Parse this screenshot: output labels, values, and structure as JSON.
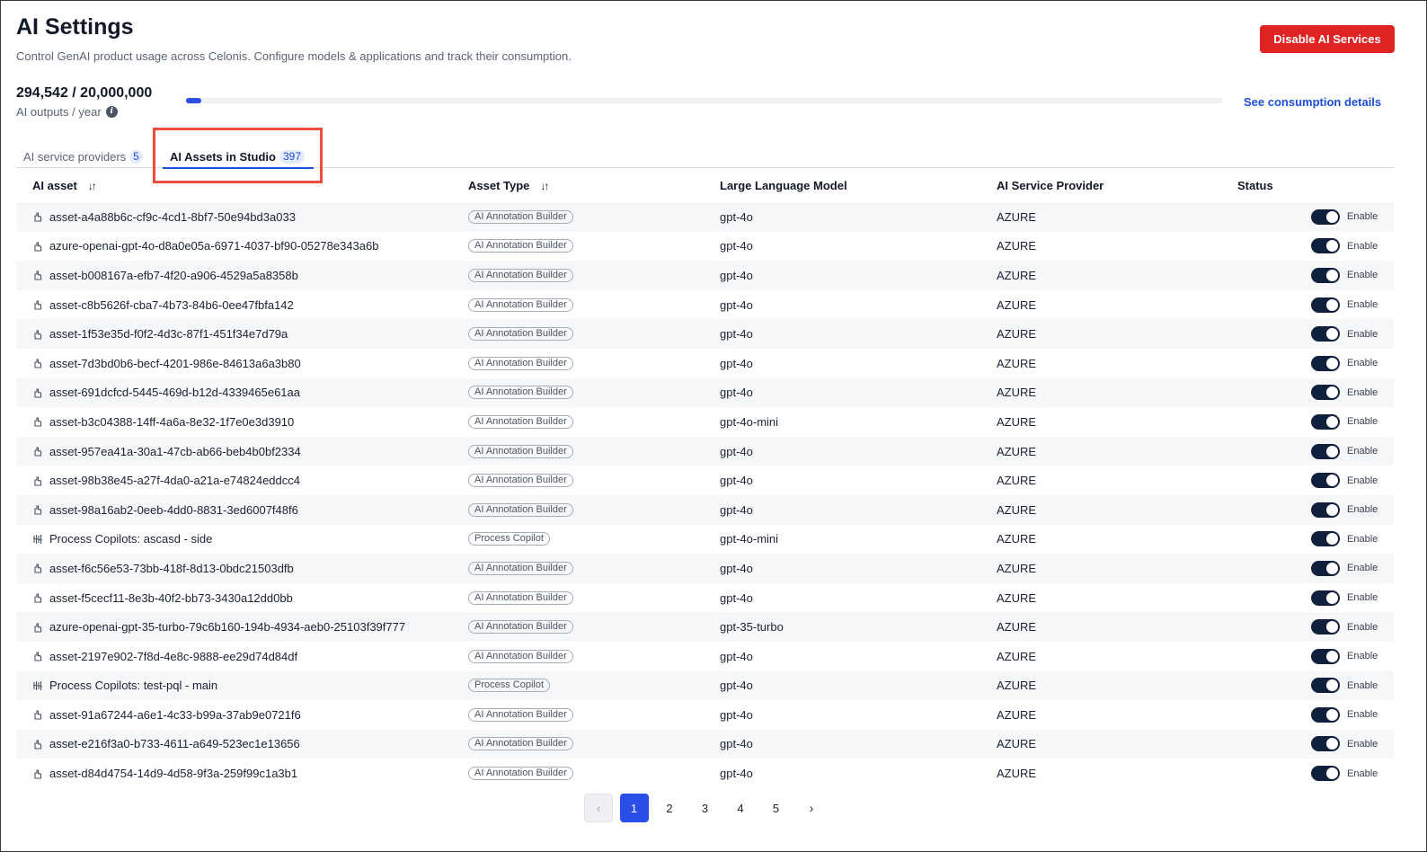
{
  "header": {
    "title": "AI Settings",
    "subtitle": "Control GenAI product usage across Celonis. Configure models & applications and track their consumption.",
    "disable_button": "Disable AI Services"
  },
  "usage": {
    "value": "294,542 / 20,000,000",
    "label": "AI outputs / year",
    "progress_fraction": 0.0147,
    "details_link": "See consumption details"
  },
  "tabs": [
    {
      "label": "AI service providers",
      "count": "5"
    },
    {
      "label": "AI Assets in Studio",
      "count": "397"
    }
  ],
  "table": {
    "columns": [
      "AI asset",
      "Asset Type",
      "Large Language Model",
      "AI Service Provider",
      "Status"
    ],
    "rows": [
      {
        "icon": "annotation-builder-icon",
        "asset": "asset-a4a88b6c-cf9c-4cd1-8bf7-50e94bd3a033",
        "type": "AI Annotation Builder",
        "llm": "gpt-4o",
        "provider": "AZURE",
        "status": "Enable"
      },
      {
        "icon": "annotation-builder-icon",
        "asset": "azure-openai-gpt-4o-d8a0e05a-6971-4037-bf90-05278e343a6b",
        "type": "AI Annotation Builder",
        "llm": "gpt-4o",
        "provider": "AZURE",
        "status": "Enable"
      },
      {
        "icon": "annotation-builder-icon",
        "asset": "asset-b008167a-efb7-4f20-a906-4529a5a8358b",
        "type": "AI Annotation Builder",
        "llm": "gpt-4o",
        "provider": "AZURE",
        "status": "Enable"
      },
      {
        "icon": "annotation-builder-icon",
        "asset": "asset-c8b5626f-cba7-4b73-84b6-0ee47fbfa142",
        "type": "AI Annotation Builder",
        "llm": "gpt-4o",
        "provider": "AZURE",
        "status": "Enable"
      },
      {
        "icon": "annotation-builder-icon",
        "asset": "asset-1f53e35d-f0f2-4d3c-87f1-451f34e7d79a",
        "type": "AI Annotation Builder",
        "llm": "gpt-4o",
        "provider": "AZURE",
        "status": "Enable"
      },
      {
        "icon": "annotation-builder-icon",
        "asset": "asset-7d3bd0b6-becf-4201-986e-84613a6a3b80",
        "type": "AI Annotation Builder",
        "llm": "gpt-4o",
        "provider": "AZURE",
        "status": "Enable"
      },
      {
        "icon": "annotation-builder-icon",
        "asset": "asset-691dcfcd-5445-469d-b12d-4339465e61aa",
        "type": "AI Annotation Builder",
        "llm": "gpt-4o",
        "provider": "AZURE",
        "status": "Enable"
      },
      {
        "icon": "annotation-builder-icon",
        "asset": "asset-b3c04388-14ff-4a6a-8e32-1f7e0e3d3910",
        "type": "AI Annotation Builder",
        "llm": "gpt-4o-mini",
        "provider": "AZURE",
        "status": "Enable"
      },
      {
        "icon": "annotation-builder-icon",
        "asset": "asset-957ea41a-30a1-47cb-ab66-beb4b0bf2334",
        "type": "AI Annotation Builder",
        "llm": "gpt-4o",
        "provider": "AZURE",
        "status": "Enable"
      },
      {
        "icon": "annotation-builder-icon",
        "asset": "asset-98b38e45-a27f-4da0-a21a-e74824eddcc4",
        "type": "AI Annotation Builder",
        "llm": "gpt-4o",
        "provider": "AZURE",
        "status": "Enable"
      },
      {
        "icon": "annotation-builder-icon",
        "asset": "asset-98a16ab2-0eeb-4dd0-8831-3ed6007f48f6",
        "type": "AI Annotation Builder",
        "llm": "gpt-4o",
        "provider": "AZURE",
        "status": "Enable"
      },
      {
        "icon": "process-copilot-icon",
        "asset": "Process Copilots: ascasd - side",
        "type": "Process Copilot",
        "llm": "gpt-4o-mini",
        "provider": "AZURE",
        "status": "Enable"
      },
      {
        "icon": "annotation-builder-icon",
        "asset": "asset-f6c56e53-73bb-418f-8d13-0bdc21503dfb",
        "type": "AI Annotation Builder",
        "llm": "gpt-4o",
        "provider": "AZURE",
        "status": "Enable"
      },
      {
        "icon": "annotation-builder-icon",
        "asset": "asset-f5cecf11-8e3b-40f2-bb73-3430a12dd0bb",
        "type": "AI Annotation Builder",
        "llm": "gpt-4o",
        "provider": "AZURE",
        "status": "Enable"
      },
      {
        "icon": "annotation-builder-icon",
        "asset": "azure-openai-gpt-35-turbo-79c6b160-194b-4934-aeb0-25103f39f777",
        "type": "AI Annotation Builder",
        "llm": "gpt-35-turbo",
        "provider": "AZURE",
        "status": "Enable"
      },
      {
        "icon": "annotation-builder-icon",
        "asset": "asset-2197e902-7f8d-4e8c-9888-ee29d74d84df",
        "type": "AI Annotation Builder",
        "llm": "gpt-4o",
        "provider": "AZURE",
        "status": "Enable"
      },
      {
        "icon": "process-copilot-icon",
        "asset": "Process Copilots: test-pql - main",
        "type": "Process Copilot",
        "llm": "gpt-4o",
        "provider": "AZURE",
        "status": "Enable"
      },
      {
        "icon": "annotation-builder-icon",
        "asset": "asset-91a67244-a6e1-4c33-b99a-37ab9e0721f6",
        "type": "AI Annotation Builder",
        "llm": "gpt-4o",
        "provider": "AZURE",
        "status": "Enable"
      },
      {
        "icon": "annotation-builder-icon",
        "asset": "asset-e216f3a0-b733-4611-a649-523ec1e13656",
        "type": "AI Annotation Builder",
        "llm": "gpt-4o",
        "provider": "AZURE",
        "status": "Enable"
      },
      {
        "icon": "annotation-builder-icon",
        "asset": "asset-d84d4754-14d9-4d58-9f3a-259f99c1a3b1",
        "type": "AI Annotation Builder",
        "llm": "gpt-4o",
        "provider": "AZURE",
        "status": "Enable"
      }
    ]
  },
  "pagination": {
    "pages": [
      "1",
      "2",
      "3",
      "4",
      "5"
    ],
    "current": "1",
    "prev_icon": "chevron-left-icon",
    "next_icon": "chevron-right-icon"
  },
  "colors": {
    "accent": "#2c4ee8",
    "danger": "#e02424",
    "toggle_on": "#0f1f3d",
    "highlight": "#ef4c3c"
  }
}
